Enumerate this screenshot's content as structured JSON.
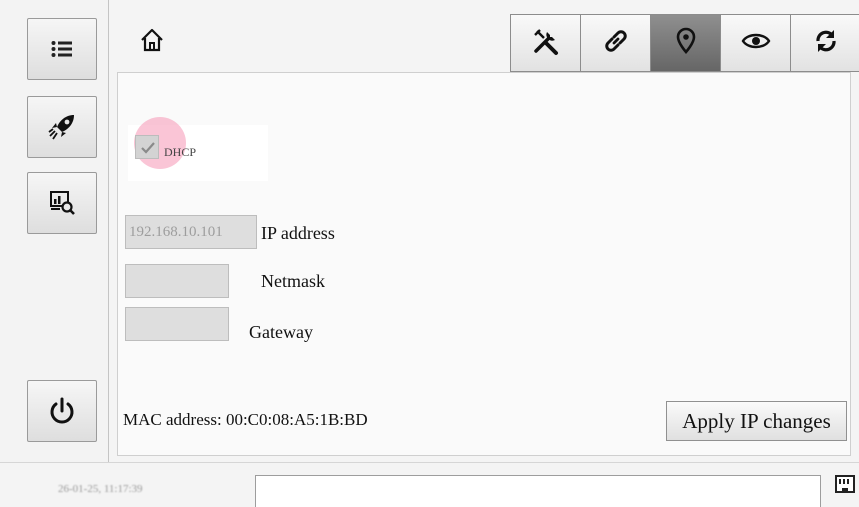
{
  "sidebar": {
    "items": [
      {
        "name": "menu",
        "icon": "list-icon"
      },
      {
        "name": "launch",
        "icon": "rocket-icon"
      },
      {
        "name": "monitor",
        "icon": "chart-search-icon"
      },
      {
        "name": "power",
        "icon": "power-icon"
      }
    ]
  },
  "topbar": {
    "home_icon": "home-icon",
    "tabs": [
      {
        "icon": "tools-icon",
        "active": false
      },
      {
        "icon": "link-icon",
        "active": false
      },
      {
        "icon": "map-pin-icon",
        "active": true
      },
      {
        "icon": "eye-icon",
        "active": false
      },
      {
        "icon": "refresh-icon",
        "active": false
      }
    ]
  },
  "network": {
    "dhcp_label": "DHCP",
    "dhcp_checked": true,
    "ip_value": "192.168.10.101",
    "ip_label": "IP address",
    "netmask_value": "",
    "netmask_label": "Netmask",
    "gateway_value": "",
    "gateway_label": "Gateway",
    "mac_text": "MAC address: 00:C0:08:A5:1B:BD",
    "apply_label": "Apply IP changes"
  },
  "status": {
    "datetime": "26-01-25, 11:17:39",
    "message": "",
    "connection_icon": "ethernet-icon"
  },
  "colors": {
    "active_tab": "#7a7a7a",
    "touch_highlight": "#f696b4"
  }
}
